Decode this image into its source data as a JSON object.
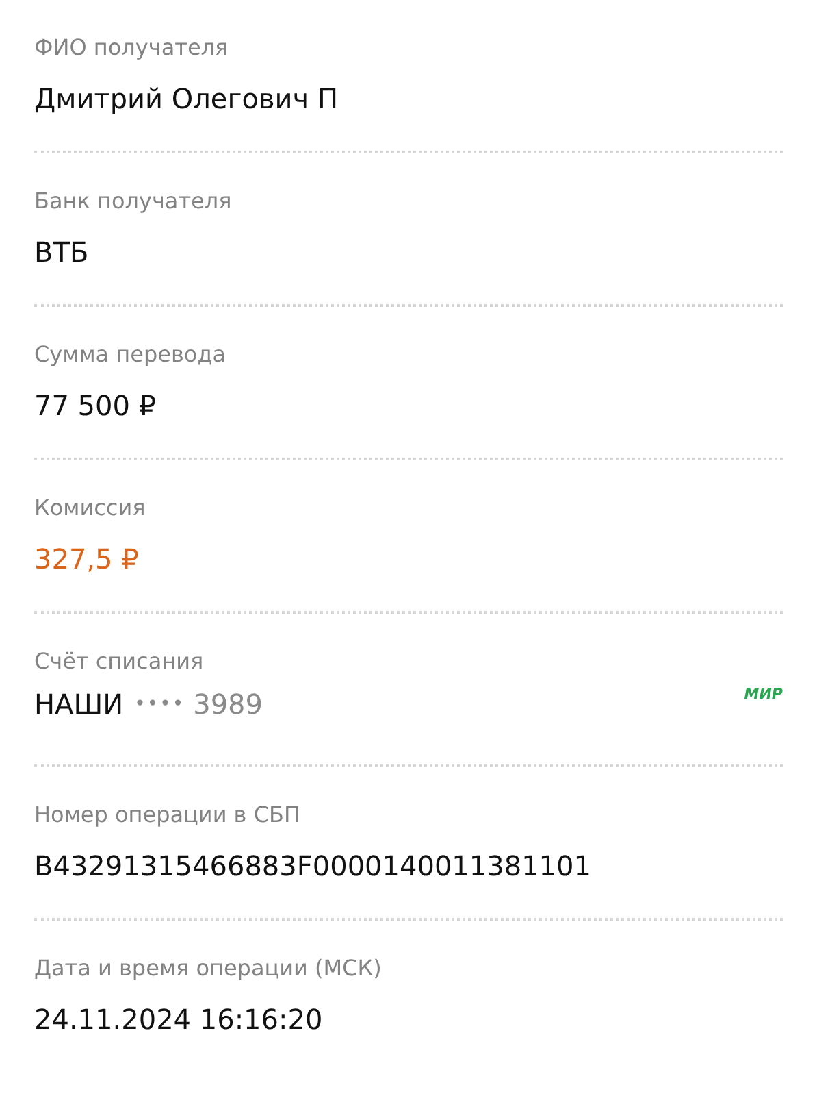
{
  "fields": [
    {
      "kind": "plain",
      "label": "ФИО получателя",
      "value": "Дмитрий Олегович П"
    },
    {
      "kind": "plain",
      "label": "Банк получателя",
      "value": "ВТБ"
    },
    {
      "kind": "plain",
      "label": "Сумма перевода",
      "value": "77 500 ₽"
    },
    {
      "kind": "accent",
      "label": "Комиссия",
      "value": "327,5 ₽"
    },
    {
      "kind": "account",
      "label": "Счёт списания",
      "value": "НАШИ",
      "mask": "••••",
      "last_digits": "3989",
      "card_logo": "МИР"
    },
    {
      "kind": "plain",
      "label": "Номер операции в СБП",
      "value": "B43291315466883F0000140011381101"
    },
    {
      "kind": "plain",
      "label": "Дата и время операции (МСК)",
      "value": "24.11.2024 16:16:20"
    }
  ]
}
